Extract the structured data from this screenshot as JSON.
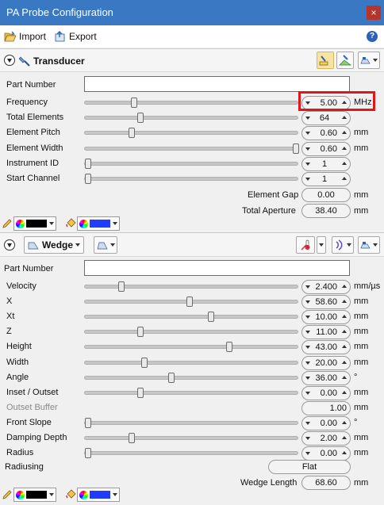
{
  "window": {
    "title": "PA Probe Configuration",
    "close_glyph": "×"
  },
  "menu": {
    "import_label": "Import",
    "export_label": "Export",
    "help_glyph": "?"
  },
  "transducer": {
    "title": "Transducer",
    "part_number_label": "Part Number",
    "part_number_value": "",
    "rows": [
      {
        "label": "Frequency",
        "value": "5.00",
        "unit": "MHz",
        "level": 0.22
      },
      {
        "label": "Total Elements",
        "value": "64",
        "unit": "",
        "level": 0.25
      },
      {
        "label": "Element Pitch",
        "value": "0.60",
        "unit": "mm",
        "level": 0.21
      },
      {
        "label": "Element Width",
        "value": "0.60",
        "unit": "mm",
        "level": 1.0
      },
      {
        "label": "Instrument ID",
        "value": "1",
        "unit": "",
        "level": 0.0
      },
      {
        "label": "Start Channel",
        "value": "1",
        "unit": "",
        "level": 0.0
      }
    ],
    "element_gap": {
      "label": "Element Gap",
      "value": "0.00",
      "unit": "mm"
    },
    "total_aperture": {
      "label": "Total Aperture",
      "value": "38.40",
      "unit": "mm"
    },
    "colors": {
      "line": "#000000",
      "fill": "#1f3cff"
    }
  },
  "wedge": {
    "title": "Wedge",
    "part_number_label": "Part Number",
    "part_number_value": "",
    "rows": [
      {
        "label": "Velocity",
        "value": "2.400",
        "unit": "mm/µs",
        "level": 0.16,
        "disabled": false
      },
      {
        "label": "X",
        "value": "58.60",
        "unit": "mm",
        "level": 0.49,
        "disabled": false
      },
      {
        "label": "Xt",
        "value": "10.00",
        "unit": "mm",
        "level": 0.59,
        "disabled": false
      },
      {
        "label": "Z",
        "value": "11.00",
        "unit": "mm",
        "level": 0.25,
        "disabled": false
      },
      {
        "label": "Height",
        "value": "43.00",
        "unit": "mm",
        "level": 0.68,
        "disabled": false
      },
      {
        "label": "Width",
        "value": "20.00",
        "unit": "mm",
        "level": 0.27,
        "disabled": false
      },
      {
        "label": "Angle",
        "value": "36.00",
        "unit": "°",
        "level": 0.4,
        "disabled": false
      },
      {
        "label": "Inset / Outset",
        "value": "0.00",
        "unit": "mm",
        "level": 0.25,
        "disabled": false
      },
      {
        "label": "Outset Buffer",
        "value": "1.00",
        "unit": "mm",
        "level": null,
        "disabled": true
      },
      {
        "label": "Front Slope",
        "value": "0.00",
        "unit": "°",
        "level": 0.0,
        "disabled": false
      },
      {
        "label": "Damping Depth",
        "value": "2.00",
        "unit": "mm",
        "level": 0.21,
        "disabled": false
      },
      {
        "label": "Radius",
        "value": "0.00",
        "unit": "mm",
        "level": 0.0,
        "disabled": false
      }
    ],
    "radiusing": {
      "label": "Radiusing",
      "value": "Flat"
    },
    "wedge_length": {
      "label": "Wedge Length",
      "value": "68.60",
      "unit": "mm"
    },
    "colors": {
      "line": "#000000",
      "fill": "#1f3cff"
    }
  },
  "accent": {
    "titlebar": "#3a78c3",
    "highlight": "#e0161b"
  }
}
